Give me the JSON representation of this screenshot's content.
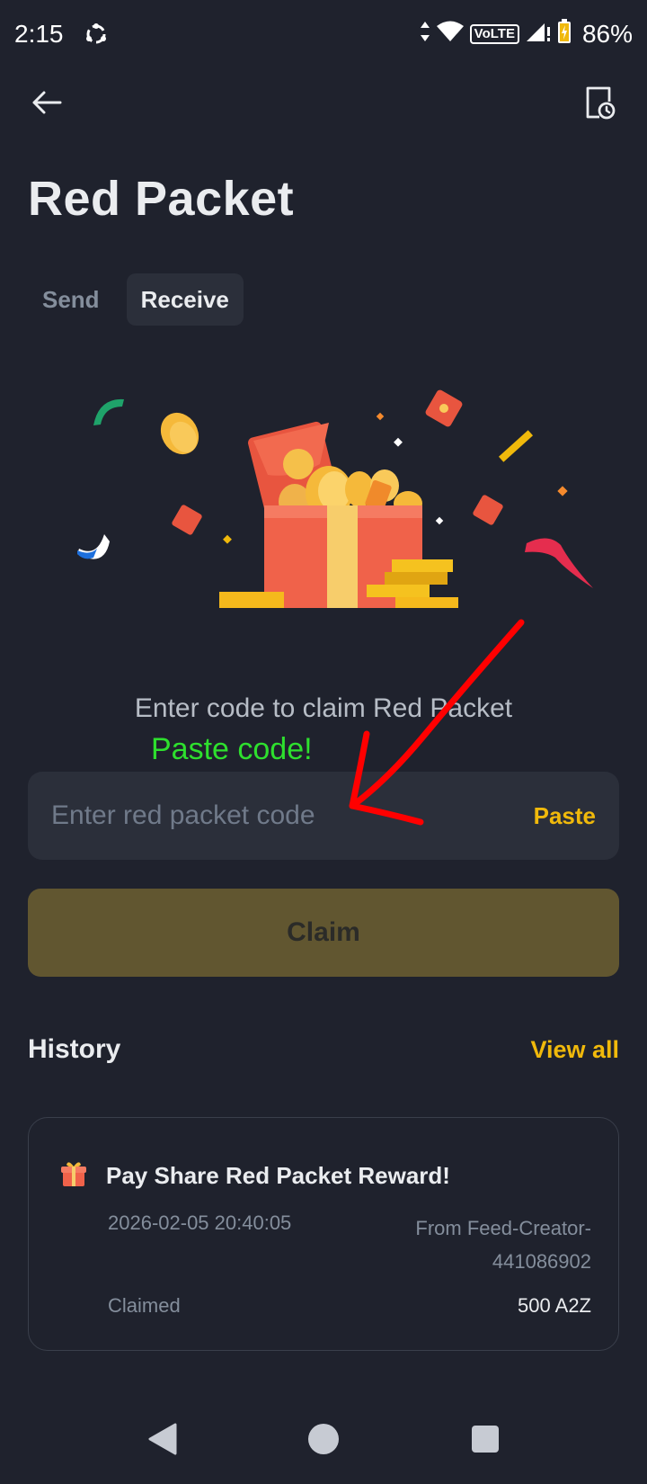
{
  "status_bar": {
    "time": "2:15",
    "battery": "86%",
    "network_badge": "VoLTE",
    "icons": [
      "sync-icon",
      "data-arrows-icon",
      "wifi-icon",
      "signal-icon",
      "battery-charging-icon"
    ]
  },
  "nav": {
    "back_icon": "arrow-left-icon",
    "history_icon": "document-clock-icon"
  },
  "page": {
    "title": "Red Packet"
  },
  "tabs": [
    {
      "label": "Send",
      "active": false
    },
    {
      "label": "Receive",
      "active": true
    }
  ],
  "claim_section": {
    "prompt": "Enter code to claim Red Packet",
    "annotation": "Paste code!",
    "input_placeholder": "Enter red packet code",
    "input_value": "",
    "paste_label": "Paste",
    "claim_label": "Claim"
  },
  "history": {
    "title": "History",
    "view_all_label": "View all",
    "items": [
      {
        "icon": "gift-icon",
        "title": "Pay Share Red Packet Reward!",
        "datetime": "2026-02-05 20:40:05",
        "from_line1": "From Feed-Creator-",
        "from_line2": "441086902",
        "status": "Claimed",
        "amount": "500 A2Z"
      }
    ]
  },
  "colors": {
    "background": "#1f222d",
    "surface": "#2b2f3a",
    "accent": "#f0b90b",
    "claim_disabled": "#615630",
    "annotation_green": "#2ee02e",
    "annotation_red": "#ff0000"
  },
  "system_nav": {
    "icons": [
      "back-triangle-icon",
      "home-circle-icon",
      "recents-square-icon"
    ]
  }
}
